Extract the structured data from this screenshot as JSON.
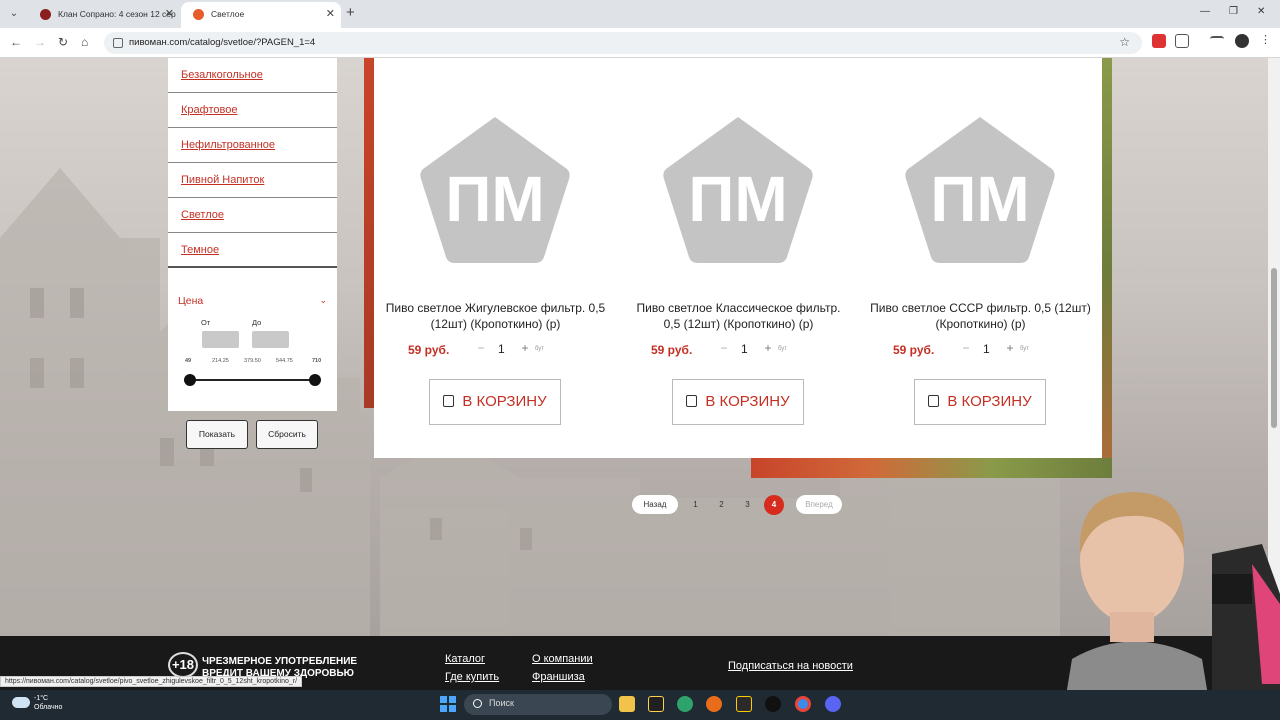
{
  "browser": {
    "tabs": [
      {
        "title": "Клан Сопрано: 4 сезон 12 сер",
        "active": false
      },
      {
        "title": "Светлое",
        "active": true
      }
    ],
    "url": "пивоман.com/catalog/svetloe/?PAGEN_1=4",
    "status_url": "https://пивоман.com/catalog/svetloe/pivo_svetloe_zhigulevskoe_filtr_0_5_12sht_kropotkino_r/"
  },
  "sidebar": {
    "categories": [
      "Безалкогольное",
      "Крафтовое",
      "Нефильтрованное",
      "Пивной Напиток",
      "Светлое",
      "Темное"
    ],
    "price_title": "Цена",
    "from_label": "От",
    "to_label": "До",
    "ticks": [
      "49",
      "214.25",
      "379.50",
      "544.75",
      "710"
    ],
    "show_button": "Показать",
    "reset_button": "Сбросить"
  },
  "products": [
    {
      "logo_text": "ПМ",
      "name": "Пиво светлое Жигулевское фильтр. 0,5 (12шт) (Кропоткино) (р)",
      "price": "59 руб.",
      "qty": "1",
      "unit": "бут",
      "cart_label": "В КОРЗИНУ"
    },
    {
      "logo_text": "ПМ",
      "name": "Пиво светлое Классическое фильтр. 0,5 (12шт) (Кропоткино) (р)",
      "price": "59 руб.",
      "qty": "1",
      "unit": "бут",
      "cart_label": "В КОРЗИНУ"
    },
    {
      "logo_text": "ПМ",
      "name": "Пиво светлое СССР фильтр. 0,5 (12шт) (Кропоткино) (р)",
      "price": "59 руб.",
      "qty": "1",
      "unit": "бут",
      "cart_label": "В КОРЗИНУ"
    }
  ],
  "pagination": {
    "prev": "Назад",
    "pages": [
      "1",
      "2",
      "3",
      "4"
    ],
    "current": "4",
    "next": "Вперед"
  },
  "footer": {
    "age_badge": "+18",
    "warning": "ЧРЕЗМЕРНОЕ УПОТРЕБЛЕНИЕ ВРЕДИТ ВАШЕМУ ЗДОРОВЬЮ",
    "links_col1": [
      "Каталог",
      "Где купить"
    ],
    "links_col2": [
      "О компании",
      "Франшиза"
    ],
    "subscribe": "Подписаться на новости"
  },
  "taskbar": {
    "temperature": "-1°C",
    "weather": "Облачно",
    "search_placeholder": "Поиск"
  },
  "colors": {
    "accent": "#c43024",
    "pager_active": "#d62b1d",
    "logo_gray": "#c4c4c4"
  }
}
